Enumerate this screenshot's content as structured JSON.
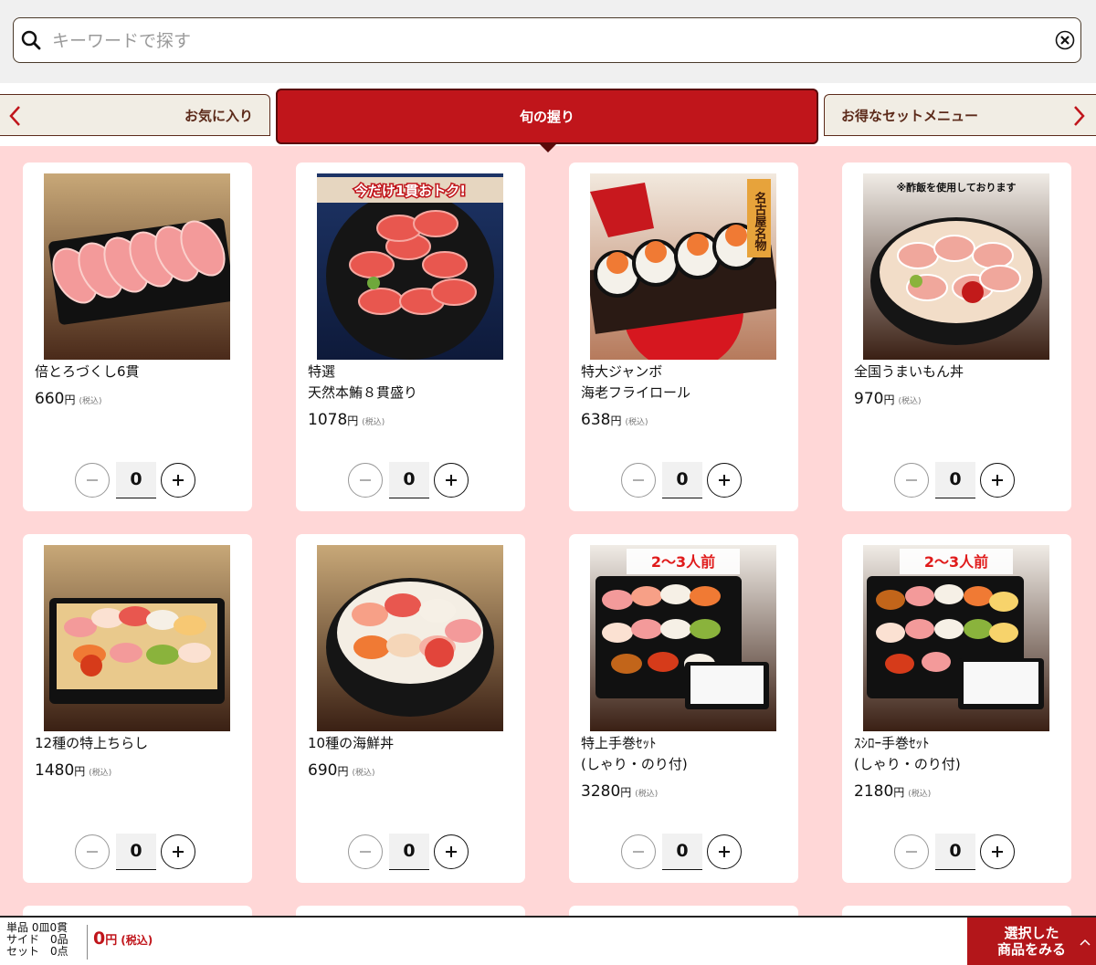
{
  "search": {
    "placeholder": "キーワードで探す",
    "value": ""
  },
  "tabs": {
    "prev_label": "お気に入り",
    "active_label": "旬の握り",
    "next_label": "お得なセットメニュー"
  },
  "products": [
    {
      "name": "倍とろづくし6貫",
      "price": "660",
      "quantity": "0",
      "image_banner": ""
    },
    {
      "name": "特選\n天然本鮪８貫盛り",
      "price": "1078",
      "quantity": "0",
      "image_banner": "今だけ1貫おトク!"
    },
    {
      "name": "特大ジャンボ\n海老フライロール",
      "price": "638",
      "quantity": "0",
      "image_banner": "名古屋名物"
    },
    {
      "name": "全国うまいもん丼",
      "price": "970",
      "quantity": "0",
      "image_banner": "※酢飯を使用しております"
    },
    {
      "name": "12種の特上ちらし",
      "price": "1480",
      "quantity": "0",
      "image_banner": ""
    },
    {
      "name": "10種の海鮮丼",
      "price": "690",
      "quantity": "0",
      "image_banner": ""
    },
    {
      "name": "特上手巻ｾｯﾄ\n(しゃり・のり付)",
      "price": "3280",
      "quantity": "0",
      "image_banner": "2〜3人前"
    },
    {
      "name": "ｽｼﾛｰ手巻ｾｯﾄ\n(しゃり・のり付)",
      "price": "2180",
      "quantity": "0",
      "image_banner": "2〜3人前"
    }
  ],
  "price_unit": "円",
  "tax_label": "(税込)",
  "footer": {
    "line1": "単品 0皿0貫",
    "line2": "サイド　0品",
    "line3": "セット　0点",
    "total": "0",
    "total_unit": "円",
    "total_tax": "(税込)",
    "cart_label_line1": "選択した",
    "cart_label_line2": "商品をみる"
  },
  "colors": {
    "accent_red": "#c0151b",
    "background_pink": "#ffd7d7",
    "tab_brown": "#5c2a1a"
  }
}
